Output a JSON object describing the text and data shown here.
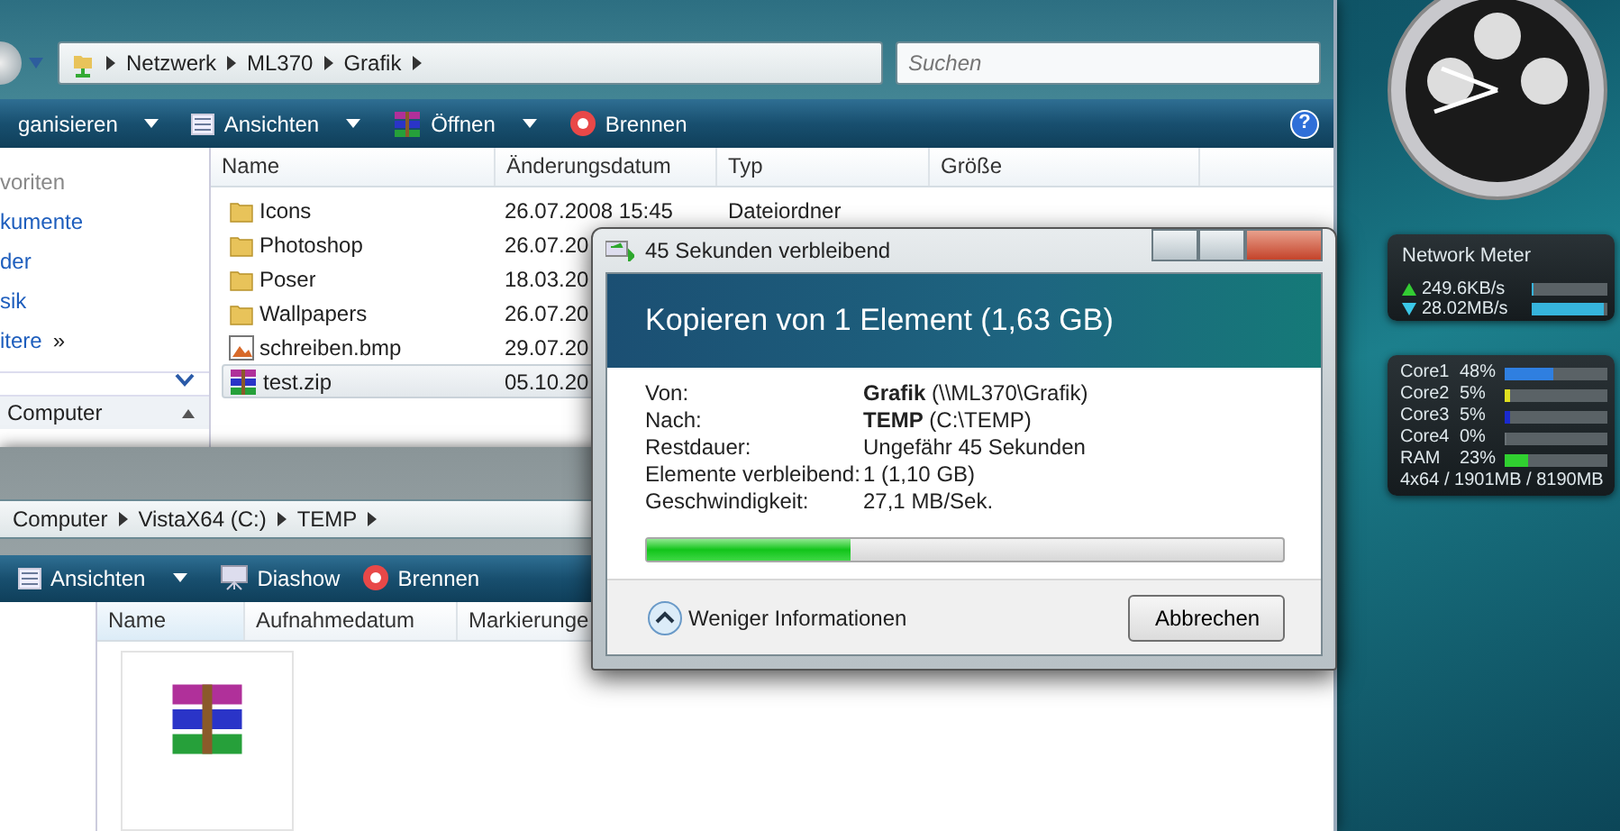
{
  "explorer_top": {
    "breadcrumbs": [
      "Netzwerk",
      "ML370",
      "Grafik"
    ],
    "search": {
      "placeholder": "Suchen"
    },
    "toolbar": [
      {
        "label": "ganisieren",
        "kind": "organize",
        "dropdown": true
      },
      {
        "label": "Ansichten",
        "kind": "views",
        "dropdown": true
      },
      {
        "label": "Öffnen",
        "kind": "open",
        "dropdown": true
      },
      {
        "label": "Brennen",
        "kind": "burn",
        "dropdown": false
      }
    ],
    "help": "?",
    "nav": [
      {
        "label": "voriten",
        "kind": "header"
      },
      {
        "label": "kumente",
        "kind": "link"
      },
      {
        "label": "der",
        "kind": "link"
      },
      {
        "label": "sik",
        "kind": "link"
      },
      {
        "label": "itere",
        "kind": "link",
        "more": "»"
      }
    ],
    "folders_label": "Computer",
    "columns": [
      "Name",
      "Änderungsdatum",
      "Typ",
      "Größe"
    ],
    "rows": [
      {
        "name": "Icons",
        "date": "26.07.2008 15:45",
        "type": "Dateiordner",
        "kind": "folder",
        "selected": false
      },
      {
        "name": "Photoshop",
        "date": "26.07.20",
        "kind": "folder",
        "selected": false
      },
      {
        "name": "Poser",
        "date": "18.03.20",
        "kind": "folder",
        "selected": false
      },
      {
        "name": "Wallpapers",
        "date": "26.07.20",
        "kind": "folder",
        "selected": false
      },
      {
        "name": "schreiben.bmp",
        "date": "29.07.20",
        "kind": "image",
        "selected": false
      },
      {
        "name": "test.zip",
        "date": "05.10.20",
        "kind": "archive",
        "selected": true
      }
    ]
  },
  "explorer_bottom": {
    "breadcrumbs": [
      "Computer",
      "VistaX64 (C:)",
      "TEMP"
    ],
    "toolbar": [
      {
        "label": "Ansichten",
        "kind": "views",
        "dropdown": true
      },
      {
        "label": "Diashow",
        "kind": "slideshow",
        "dropdown": false
      },
      {
        "label": "Brennen",
        "kind": "burn",
        "dropdown": false
      }
    ],
    "columns": [
      "Name",
      "Aufnahmedatum",
      "Markierunge"
    ],
    "files": [
      {
        "kind": "archive"
      }
    ]
  },
  "copy_dialog": {
    "title": "45 Sekunden verbleibend",
    "heading": "Kopieren von 1 Element (1,63 GB)",
    "details": [
      {
        "label": "Von:",
        "value": "**Grafik** (\\\\ML370\\Grafik)"
      },
      {
        "label": "Nach:",
        "value": "**TEMP** (C:\\TEMP)"
      },
      {
        "label": "Restdauer:",
        "value": "Ungefähr 45 Sekunden"
      },
      {
        "label": "Elemente verbleibend:",
        "value": "1 (1,10 GB)"
      },
      {
        "label": "Geschwindigkeit:",
        "value": "27,1 MB/Sek."
      }
    ],
    "progress": {
      "level": 0.32
    },
    "details_toggle": "Weniger Informationen",
    "cancel_button": "Abbrechen"
  },
  "network_meter": {
    "title": "Network Meter",
    "rates": [
      {
        "kind": "up",
        "reading": "249.6KB/s",
        "level": 0.02
      },
      {
        "kind": "down",
        "reading": "28.02MB/s",
        "level": 0.95
      }
    ]
  },
  "cpu_meter": {
    "items": [
      {
        "name": "Core1",
        "reading": "48%",
        "level": 0.48,
        "color": "#2f7fe0"
      },
      {
        "name": "Core2",
        "reading": "5%",
        "level": 0.05,
        "color": "#e0e020"
      },
      {
        "name": "Core3",
        "reading": "5%",
        "level": 0.05,
        "color": "#1a2ad0"
      },
      {
        "name": "Core4",
        "reading": "0%",
        "level": 0.0
      },
      {
        "name": "RAM",
        "reading": "23%",
        "level": 0.23,
        "color": "#30d030"
      }
    ],
    "summary": "4x64 / 1901MB / 8190MB"
  }
}
